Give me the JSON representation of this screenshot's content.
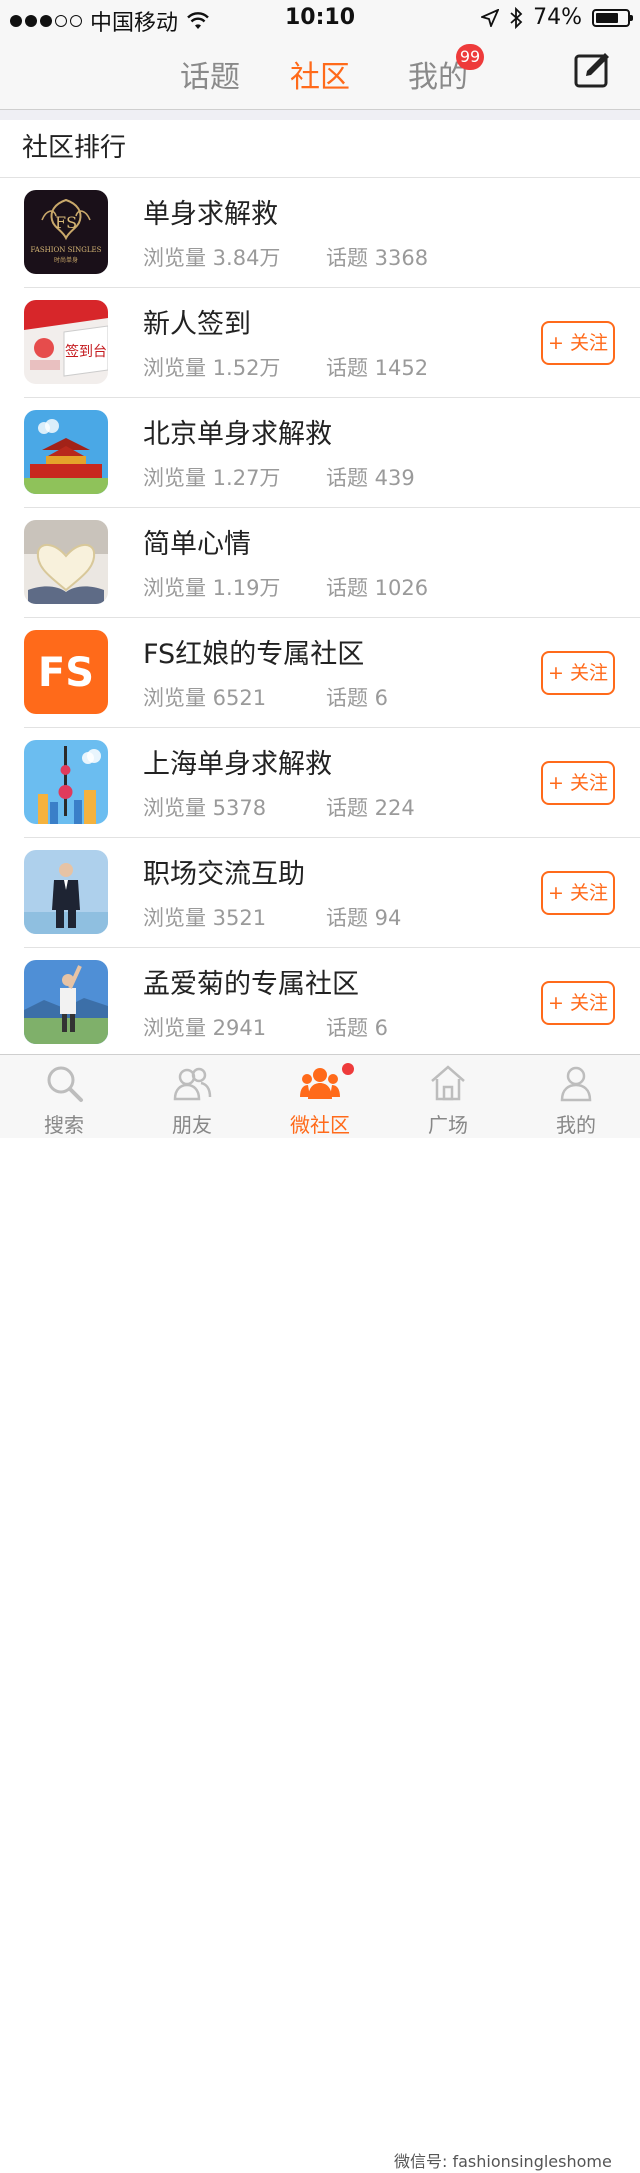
{
  "status_bar": {
    "carrier": "中国移动",
    "time": "10:10",
    "battery": "74%",
    "battery_level": 0.74
  },
  "top_nav": {
    "tabs": [
      {
        "label": "话题"
      },
      {
        "label": "社区"
      },
      {
        "label": "我的"
      }
    ],
    "active_tab": "社区",
    "mine_badge": "99",
    "compose_icon": "compose-icon"
  },
  "section": {
    "title": "社区排行"
  },
  "communities": [
    {
      "name": "单身求解救",
      "views": "浏览量 3.84万",
      "topics": "话题 3368",
      "follow": ""
    },
    {
      "name": "新人签到",
      "views": "浏览量 1.52万",
      "topics": "话题 1452",
      "follow": "+ 关注",
      "thumb_text": "签到台"
    },
    {
      "name": "北京单身求解救",
      "views": "浏览量 1.27万",
      "topics": "话题 439",
      "follow": ""
    },
    {
      "name": "简单心情",
      "views": "浏览量 1.19万",
      "topics": "话题 1026",
      "follow": ""
    },
    {
      "name": "FS红娘的专属社区",
      "views": "浏览量 6521",
      "topics": "话题 6",
      "follow": "+ 关注",
      "thumb_text": "FS"
    },
    {
      "name": "上海单身求解救",
      "views": "浏览量 5378",
      "topics": "话题 224",
      "follow": "+ 关注"
    },
    {
      "name": "职场交流互助",
      "views": "浏览量 3521",
      "topics": "话题 94",
      "follow": "+ 关注"
    },
    {
      "name": "孟爱菊的专属社区",
      "views": "浏览量 2941",
      "topics": "话题 6",
      "follow": "+ 关注"
    }
  ],
  "logo_text": {
    "line1": "FASHION SINGLES",
    "line2": "时尚单身"
  },
  "tab_bar": {
    "items": [
      {
        "label": "搜索",
        "icon": "search-icon"
      },
      {
        "label": "朋友",
        "icon": "friends-icon"
      },
      {
        "label": "微社区",
        "icon": "community-icon"
      },
      {
        "label": "广场",
        "icon": "square-icon"
      },
      {
        "label": "我的",
        "icon": "profile-icon"
      }
    ],
    "active": "微社区"
  },
  "watermark": "微信号: fashionsingleshome",
  "colors": {
    "accent": "#ff6a1a",
    "badge": "#ee3b3b"
  }
}
